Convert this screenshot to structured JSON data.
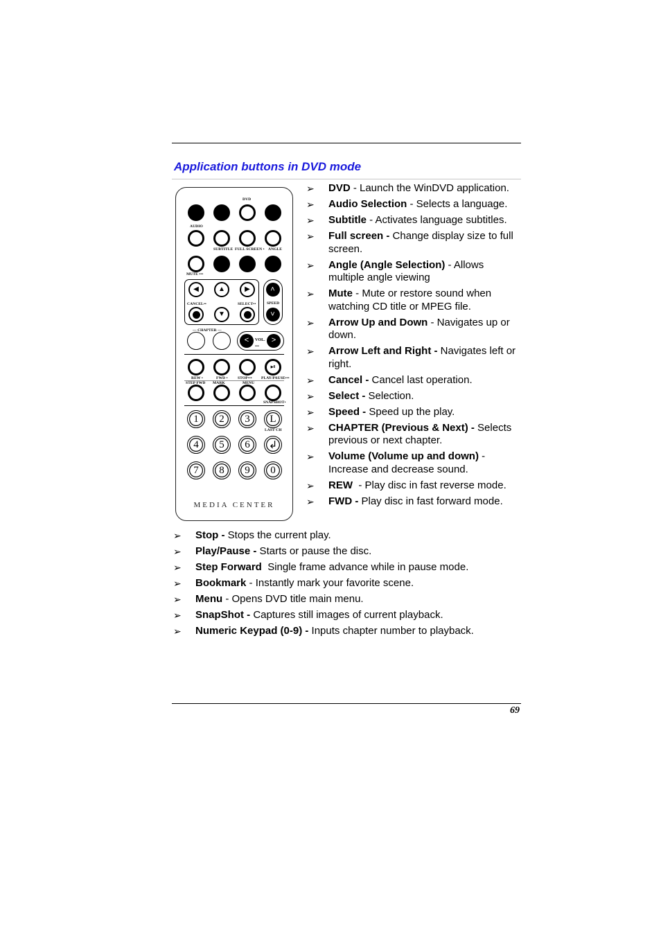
{
  "section_title": "Application buttons in DVD mode",
  "page_number": "69",
  "colors": {
    "title": "#1a1adc",
    "rule": "#000000",
    "title_rule": "#c8c8c8"
  },
  "remote": {
    "labels": {
      "dvd": "DVD",
      "audio": "AUDIO",
      "subtitle": "SUBTITLE",
      "full_screen": "FULL SCREEN •",
      "angle": "ANGLE",
      "mute": "MUTE •••",
      "cancel": "CANCEL••",
      "select": "SELECT••",
      "speed": "SPEED",
      "chapter": "— CHAPTER —",
      "vol": "VOL.",
      "vol_dots": "•••",
      "rew": "REW •",
      "fwd": "FWD •",
      "stop": "STOP•••",
      "play_pause": "PLAY/PAUSE•••",
      "step_fwd": "STEP FWD",
      "mark": "MARK",
      "menu": "MENU",
      "snapshot": "SNAPSHOT•",
      "last_ch": "LAST CH",
      "play_pause_glyph": "▶II",
      "media_center": "MEDIA CENTER"
    },
    "numeric_keys": [
      "1",
      "2",
      "3",
      "4",
      "5",
      "6",
      "7",
      "8",
      "9",
      "0"
    ],
    "icons": {
      "arrow_left": "◀",
      "arrow_up": "▲",
      "arrow_right": "▶",
      "arrow_down": "▼",
      "chevron_up": "˄",
      "chevron_down": "˅",
      "chevron_left": "<",
      "chevron_right": ">",
      "last_ch": "L",
      "enter": "↲"
    }
  },
  "bullet_glyph": "➢",
  "right_items": [
    {
      "term": "DVD",
      "desc": " - Launch the WinDVD application."
    },
    {
      "term": "Audio Selection",
      "desc": " - Selects a language."
    },
    {
      "term": "Subtitle",
      "desc": " - Activates language subtitles."
    },
    {
      "term": "Full screen -",
      "desc": " Change display size to full screen."
    },
    {
      "term": "Angle (Angle Selection)",
      "desc": " - Allows multiple angle viewing"
    },
    {
      "term": "Mute",
      "desc": " - Mute or restore sound when watching CD title or MPEG file."
    },
    {
      "term": "Arrow Up and Down",
      "desc": " - Navigates up or down."
    },
    {
      "term": "Arrow Left and Right -",
      "desc": " Navigates left or right."
    },
    {
      "term": "Cancel -",
      "desc": " Cancel last operation."
    },
    {
      "term": "Select -",
      "desc": " Selection."
    },
    {
      "term": "Speed -",
      "desc": " Speed up the play."
    },
    {
      "term": "CHAPTER (Previous & Next) -",
      "desc": " Selects previous or next chapter."
    },
    {
      "term": "Volume (Volume up and down)",
      "desc": " - Increase and decrease sound."
    },
    {
      "term": "REW",
      "desc": "  - Play disc in fast reverse mode."
    },
    {
      "term": "FWD -",
      "desc": " Play disc in fast forward mode."
    }
  ],
  "bottom_items": [
    {
      "term": "Stop -",
      "desc": " Stops the current play."
    },
    {
      "term": "Play/Pause -",
      "desc": " Starts or pause the disc."
    },
    {
      "term": "Step Forward",
      "desc": "  Single frame advance while in pause mode."
    },
    {
      "term": "Bookmark",
      "desc": " - Instantly mark your favorite scene."
    },
    {
      "term": "Menu",
      "desc": " - Opens DVD title main menu."
    },
    {
      "term": "SnapShot -",
      "desc": " Captures still images of current playback."
    },
    {
      "term": "Numeric Keypad (0-9) -",
      "desc": " Inputs chapter number to playback."
    }
  ]
}
